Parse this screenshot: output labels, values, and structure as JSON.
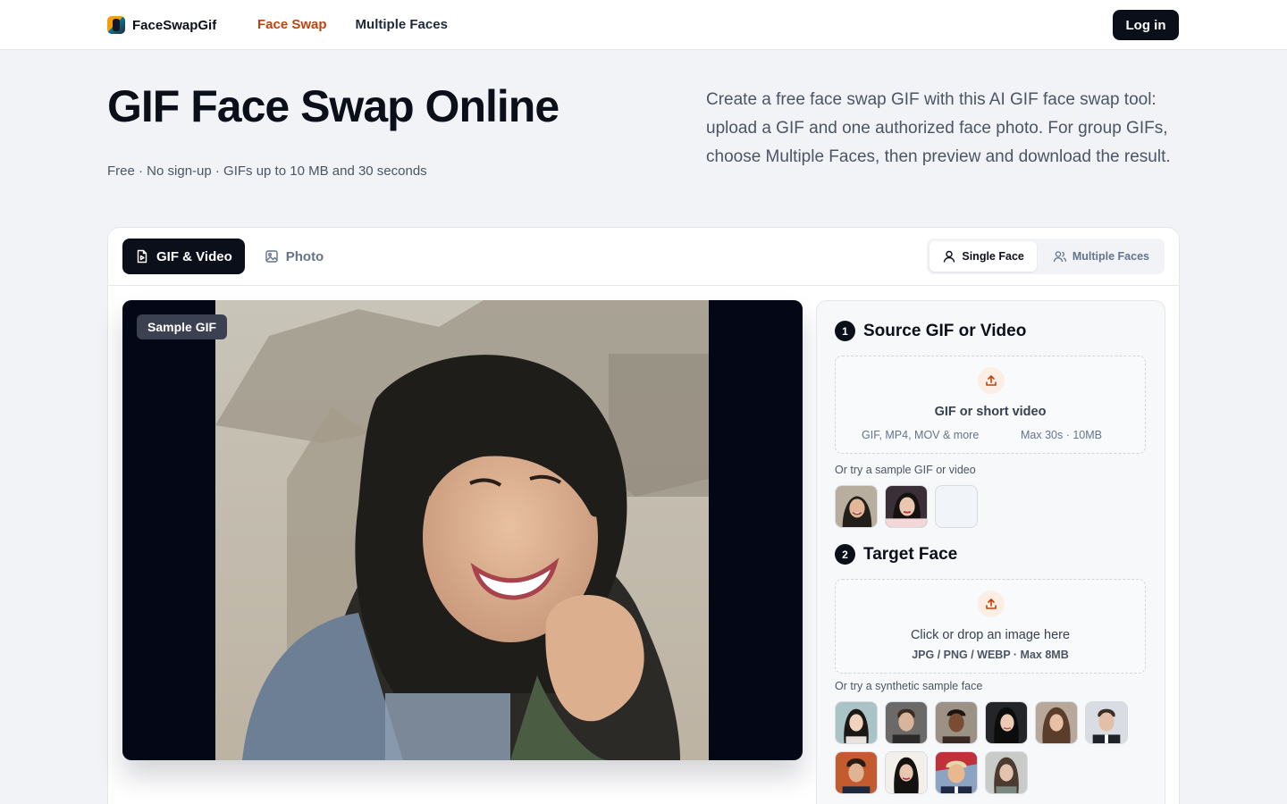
{
  "header": {
    "brand": "FaceSwapGif",
    "nav": [
      {
        "label": "Face Swap",
        "active": true
      },
      {
        "label": "Multiple Faces",
        "active": false
      }
    ],
    "login_label": "Log in"
  },
  "hero": {
    "title": "GIF Face Swap Online",
    "subtitle": "Free · No sign-up · GIFs up to 10 MB and 30 seconds",
    "description": "Create a free face swap GIF with this AI GIF face swap tool: upload a GIF and one authorized face photo. For group GIFs, choose Multiple Faces, then preview and download the result."
  },
  "mode_tabs": [
    {
      "label": "GIF & Video",
      "icon": "file-video-icon",
      "active": true
    },
    {
      "label": "Photo",
      "icon": "image-icon",
      "active": false
    }
  ],
  "face_mode": [
    {
      "label": "Single Face",
      "icon": "user-icon",
      "active": true
    },
    {
      "label": "Multiple Faces",
      "icon": "users-icon",
      "active": false
    }
  ],
  "preview": {
    "badge": "Sample GIF"
  },
  "source": {
    "step": "1",
    "title": "Source GIF or Video",
    "drop_title": "GIF or short video",
    "formats": "GIF, MP4, MOV & more",
    "limits": "Max 30s · 10MB",
    "sample_hint": "Or try a sample GIF or video"
  },
  "target": {
    "step": "2",
    "title": "Target Face",
    "drop_title": "Click or drop an image here",
    "formats": "JPG / PNG / WEBP · Max 8MB",
    "sample_hint": "Or try a synthetic sample face"
  },
  "colors": {
    "accent": "#c2410c",
    "dark": "#0b0f1a",
    "muted": "#64748b"
  }
}
